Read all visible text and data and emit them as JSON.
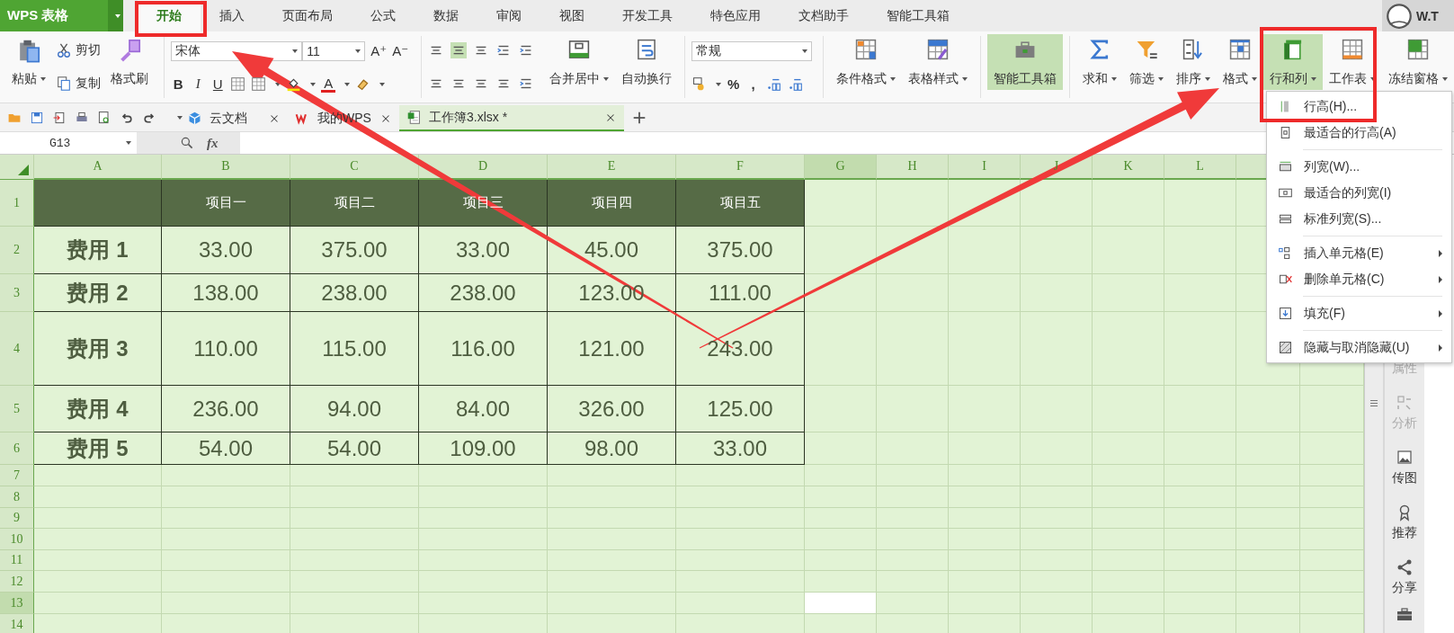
{
  "app": {
    "logo": "WPS 表格"
  },
  "menu_tabs": [
    {
      "label": "开始",
      "selected": true
    },
    {
      "label": "插入",
      "selected": false
    },
    {
      "label": "页面布局",
      "selected": false
    },
    {
      "label": "公式",
      "selected": false
    },
    {
      "label": "数据",
      "selected": false
    },
    {
      "label": "审阅",
      "selected": false
    },
    {
      "label": "视图",
      "selected": false
    },
    {
      "label": "开发工具",
      "selected": false
    },
    {
      "label": "特色应用",
      "selected": false
    },
    {
      "label": "文档助手",
      "selected": false
    },
    {
      "label": "智能工具箱",
      "selected": false
    }
  ],
  "user": {
    "name": "W.T"
  },
  "ribbon": {
    "paste": {
      "label": "粘贴",
      "kind": "paste",
      "dropdown": true,
      "selected": false
    },
    "cut": "剪切",
    "copy": "复制",
    "painter": {
      "label": "格式刷",
      "kind": "painter",
      "dropdown": false,
      "selected": false
    },
    "font": {
      "name": "宋体",
      "size": "11",
      "grow": "A⁺",
      "shrink": "A⁻",
      "color_label": "A"
    },
    "font_styles": [
      {
        "label": "B",
        "kind": "bold"
      },
      {
        "label": "I",
        "kind": "italic"
      },
      {
        "label": "U",
        "kind": "underline"
      }
    ],
    "align_buttons": [
      {
        "label": "合并居中",
        "kind": "merge",
        "dropdown": true,
        "selected": false
      },
      {
        "label": "自动换行",
        "kind": "wrap",
        "dropdown": false,
        "selected": false
      }
    ],
    "number_format": "常规",
    "number_marks": [
      "%",
      ","
    ],
    "tool_groups": [
      [
        {
          "label": "条件格式",
          "kind": "conditional",
          "dropdown": true,
          "selected": false
        },
        {
          "label": "表格样式",
          "kind": "table-style",
          "dropdown": true,
          "selected": false
        }
      ],
      [
        {
          "label": "智能工具箱",
          "kind": "toolbox",
          "dropdown": false,
          "selected": true
        }
      ],
      [
        {
          "label": "求和",
          "kind": "sum",
          "dropdown": true,
          "selected": false
        },
        {
          "label": "筛选",
          "kind": "filter",
          "dropdown": true,
          "selected": false
        },
        {
          "label": "排序",
          "kind": "sort",
          "dropdown": true,
          "selected": false
        },
        {
          "label": "格式",
          "kind": "format",
          "dropdown": true,
          "selected": false
        },
        {
          "label": "行和列",
          "kind": "rows-columns",
          "dropdown": true,
          "selected": true
        },
        {
          "label": "工作表",
          "kind": "sheet",
          "dropdown": true,
          "selected": false
        },
        {
          "label": "冻结窗格",
          "kind": "freeze",
          "dropdown": true,
          "selected": false
        }
      ]
    ]
  },
  "doc_tabs": [
    {
      "label": "云文档",
      "kind": "cloud",
      "selected": false
    },
    {
      "label": "我的WPS",
      "kind": "wps",
      "selected": false
    },
    {
      "label": "工作簿3.xlsx *",
      "kind": "workbook",
      "selected": true
    }
  ],
  "formula_bar": {
    "cell_ref": "G13",
    "fx": "fx"
  },
  "column_headers": [
    {
      "label": "A",
      "selected": false
    },
    {
      "label": "B",
      "selected": false
    },
    {
      "label": "C",
      "selected": false
    },
    {
      "label": "D",
      "selected": false
    },
    {
      "label": "E",
      "selected": false
    },
    {
      "label": "F",
      "selected": false
    },
    {
      "label": "G",
      "selected": true
    },
    {
      "label": "H",
      "selected": false
    },
    {
      "label": "I",
      "selected": false
    },
    {
      "label": "J",
      "selected": false
    },
    {
      "label": "K",
      "selected": false
    },
    {
      "label": "L",
      "selected": false
    }
  ],
  "row_headers": [
    {
      "label": "1",
      "selected": false
    },
    {
      "label": "2",
      "selected": false
    },
    {
      "label": "3",
      "selected": false
    },
    {
      "label": "4",
      "selected": false
    },
    {
      "label": "5",
      "selected": false
    },
    {
      "label": "6",
      "selected": false
    },
    {
      "label": "7",
      "selected": false
    },
    {
      "label": "8",
      "selected": false
    },
    {
      "label": "9",
      "selected": false
    },
    {
      "label": "10",
      "selected": false
    },
    {
      "label": "11",
      "selected": false
    },
    {
      "label": "12",
      "selected": false
    },
    {
      "label": "13",
      "selected": true
    },
    {
      "label": "14",
      "selected": false
    }
  ],
  "table": {
    "columns": [
      "项目一",
      "项目二",
      "项目三",
      "项目四",
      "项目五"
    ],
    "rows": [
      {
        "label": "费用 1",
        "values": [
          "33.00",
          "375.00",
          "33.00",
          "45.00",
          "375.00"
        ]
      },
      {
        "label": "费用 2",
        "values": [
          "138.00",
          "238.00",
          "238.00",
          "123.00",
          "111.00"
        ]
      },
      {
        "label": "费用 3",
        "values": [
          "110.00",
          "115.00",
          "116.00",
          "121.00",
          "243.00"
        ]
      },
      {
        "label": "费用 4",
        "values": [
          "236.00",
          "94.00",
          "84.00",
          "326.00",
          "125.00"
        ]
      },
      {
        "label": "费用 5",
        "values": [
          "54.00",
          "54.00",
          "109.00",
          "98.00",
          "33.00"
        ]
      }
    ]
  },
  "context_menu": {
    "groups": [
      [
        {
          "label": "行高(H)...",
          "kind": "row-height",
          "submenu": false
        },
        {
          "label": "最适合的行高(A)",
          "kind": "fit-row",
          "submenu": false
        }
      ],
      [
        {
          "label": "列宽(W)...",
          "kind": "col-width",
          "submenu": false
        },
        {
          "label": "最适合的列宽(I)",
          "kind": "fit-col",
          "submenu": false
        },
        {
          "label": "标准列宽(S)...",
          "kind": "std-col",
          "submenu": false
        }
      ],
      [
        {
          "label": "插入单元格(E)",
          "kind": "insert",
          "submenu": true
        },
        {
          "label": "删除单元格(C)",
          "kind": "delete",
          "submenu": true
        }
      ],
      [
        {
          "label": "填充(F)",
          "kind": "fill",
          "submenu": true
        }
      ],
      [
        {
          "label": "隐藏与取消隐藏(U)",
          "kind": "hide",
          "submenu": true
        }
      ]
    ]
  },
  "side_panel": [
    {
      "label": "属性",
      "kind": "properties",
      "disabled": true
    },
    {
      "label": "分析",
      "kind": "analysis",
      "disabled": true
    },
    {
      "label": "传图",
      "kind": "image",
      "disabled": false
    },
    {
      "label": "推荐",
      "kind": "award",
      "disabled": false
    },
    {
      "label": "分享",
      "kind": "share",
      "disabled": false
    }
  ]
}
